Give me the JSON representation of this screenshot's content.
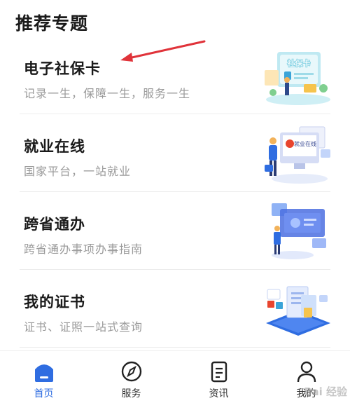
{
  "section": {
    "title": "推荐专题"
  },
  "topics": [
    {
      "title": "电子社保卡",
      "desc": "记录一生，保障一生，服务一生",
      "illustration_icon": "social-security-card-illustration",
      "card_text": "社保卡"
    },
    {
      "title": "就业在线",
      "desc": "国家平台，一站就业",
      "illustration_icon": "employment-online-illustration",
      "screen_text": "就业在线"
    },
    {
      "title": "跨省通办",
      "desc": "跨省通办事项办事指南",
      "illustration_icon": "cross-province-illustration"
    },
    {
      "title": "我的证书",
      "desc": "证书、证照一站式查询",
      "illustration_icon": "certificate-illustration"
    }
  ],
  "tabs": [
    {
      "label": "首页",
      "icon": "home-icon",
      "active": true
    },
    {
      "label": "服务",
      "icon": "compass-icon",
      "active": false
    },
    {
      "label": "资讯",
      "icon": "news-icon",
      "active": false
    },
    {
      "label": "我的",
      "icon": "user-icon",
      "active": false
    }
  ],
  "watermark": "Bai 经验",
  "colors": {
    "accent": "#2f6de1",
    "arrow": "#e0333a",
    "desc": "#9a9a9a"
  }
}
